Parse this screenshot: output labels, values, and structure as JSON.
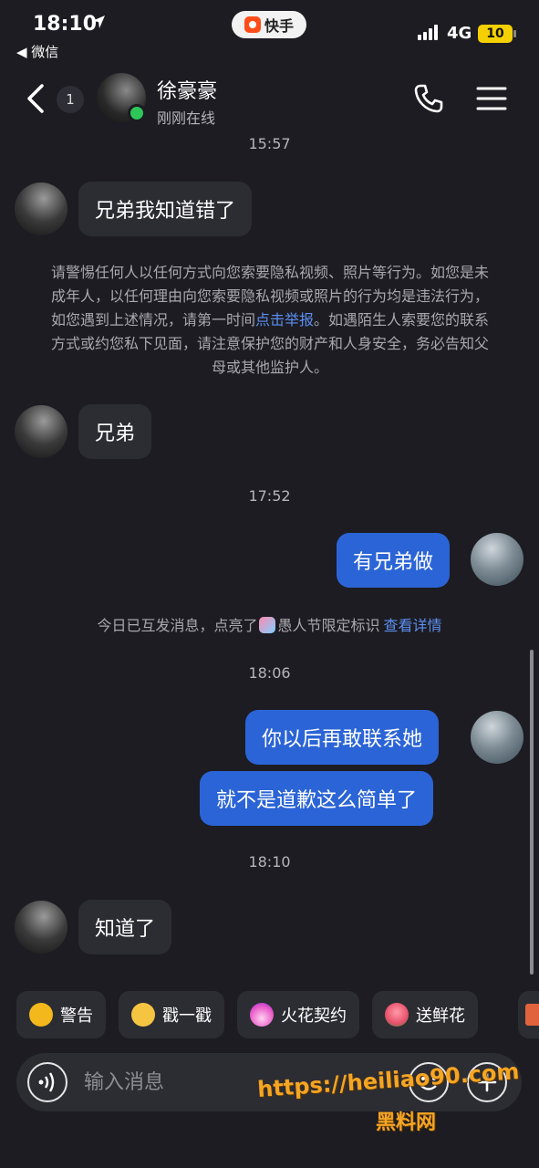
{
  "status_bar": {
    "time": "18:10",
    "back_app": "◀ 微信",
    "app_name": "快手",
    "network": "4G",
    "battery": "10"
  },
  "header": {
    "unread_count": "1",
    "contact_name": "徐豪豪",
    "contact_status": "刚刚在线",
    "online_color": "#2ec759"
  },
  "messages": [
    {
      "type": "timestamp",
      "text": "15:57"
    },
    {
      "type": "received",
      "text": "兄弟我知道错了"
    },
    {
      "type": "notice",
      "text_before": "请警惕任何人以任何方式向您索要隐私视频、照片等行为。如您是未成年人，以任何理由向您索要隐私视频或照片的行为均是违法行为，如您遇到上述情况，请第一时间",
      "link": "点击举报",
      "text_after": "。如遇陌生人索要您的联系方式或约您私下见面，请注意保护您的财产和人身安全，务必告知父母或其他监护人。"
    },
    {
      "type": "received",
      "text": "兄弟"
    },
    {
      "type": "timestamp",
      "text": "17:52"
    },
    {
      "type": "sent",
      "text": "有兄弟做"
    },
    {
      "type": "badge_notice",
      "text_before": "今日已互发消息，点亮了",
      "text_after": "愚人节限定标识",
      "link": "查看详情"
    },
    {
      "type": "timestamp",
      "text": "18:06"
    },
    {
      "type": "sent",
      "text": "你以后再敢联系她"
    },
    {
      "type": "sent",
      "text": "就不是道歉这么简单了"
    },
    {
      "type": "timestamp",
      "text": "18:10"
    },
    {
      "type": "received",
      "text": "知道了"
    }
  ],
  "quick_actions": [
    {
      "label": "警告",
      "icon": "warning-duck-icon",
      "color": "#f3b81c"
    },
    {
      "label": "戳一戳",
      "icon": "poke-emoji-icon",
      "color": "#f5c542"
    },
    {
      "label": "火花契约",
      "icon": "spark-flame-icon",
      "color": "#e85ac8"
    },
    {
      "label": "送鲜花",
      "icon": "flower-icon",
      "color": "#e8506b"
    }
  ],
  "input": {
    "placeholder": "输入消息"
  },
  "watermark": {
    "url": "https://heiliao90.com",
    "name": "黑料网"
  },
  "colors": {
    "background": "#1c1c22",
    "bubble_received": "#2c2c33",
    "bubble_sent": "#2b64d6",
    "link": "#5d8ff0"
  }
}
